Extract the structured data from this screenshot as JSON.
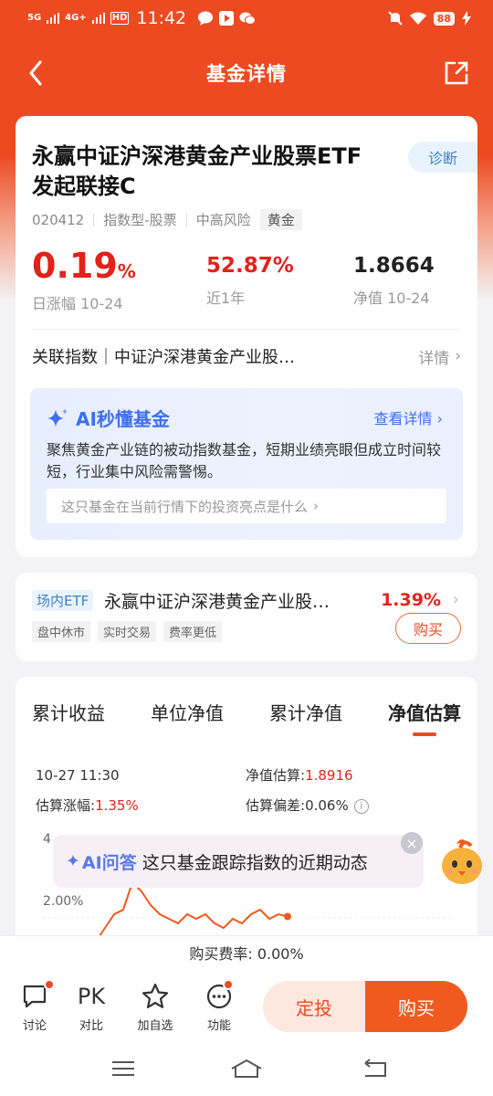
{
  "statusbar": {
    "network1": "5G",
    "network2": "4G+",
    "hd": "HD",
    "time": "11:42",
    "battery": "88"
  },
  "nav": {
    "title": "基金详情"
  },
  "fund": {
    "diag_label": "诊断",
    "name": "永赢中证沪深港黄金产业股票ETF发起联接C",
    "code": "020412",
    "type": "指数型-股票",
    "risk": "中高风险",
    "tag": "黄金",
    "daily_change": "0.19",
    "daily_change_unit": "%",
    "daily_change_label": "日涨幅 10-24",
    "year_return": "52.87%",
    "year_return_label": "近1年",
    "nav": "1.8664",
    "nav_label": "净值 10-24"
  },
  "related_index": {
    "label": "关联指数｜中证沪深港黄金产业股…",
    "detail": "详情"
  },
  "ai_summary": {
    "title": "AI秒懂基金",
    "more": "查看详情",
    "desc": "聚焦黄金产业链的被动指数基金，短期业绩亮眼但成立时间较短，行业集中风险需警惕。",
    "question": "这只基金在当前行情下的投资亮点是什么"
  },
  "etf": {
    "tag": "场内ETF",
    "name": "永赢中证沪深港黄金产业股…",
    "change": "1.39%",
    "tags": [
      "盘中休市",
      "实时交易",
      "费率更低"
    ],
    "buy": "购买"
  },
  "chart_tabs": [
    "累计收益",
    "单位净值",
    "累计净值",
    "净值估算"
  ],
  "estimate": {
    "time": "10-27 11:30",
    "nav_est_label": "净值估算:",
    "nav_est": "1.8916",
    "change_label": "估算涨幅:",
    "change": "1.35%",
    "deviation_label": "估算偏差:",
    "deviation": "0.06%"
  },
  "chart_data": {
    "type": "line",
    "ytick_labels": [
      "4",
      "2.00%"
    ],
    "color": "#ee5a1e",
    "values": [
      0.8,
      1.1,
      1.4,
      1.5,
      2.1,
      1.9,
      1.6,
      1.4,
      1.3,
      1.2,
      1.4,
      1.3,
      1.4,
      1.2,
      1.1,
      1.3,
      1.2,
      1.4,
      1.5,
      1.3,
      1.4,
      1.35
    ]
  },
  "ai_float": {
    "tag": "AI问答",
    "text": "这只基金跟踪指数的近期动态"
  },
  "fee": "购买费率: 0.00%",
  "bottombar": {
    "items": [
      {
        "icon": "",
        "label": "讨论"
      },
      {
        "icon": "PK",
        "label": "对比"
      },
      {
        "icon": "",
        "label": "加自选"
      },
      {
        "icon": "",
        "label": "功能"
      }
    ],
    "dingtou": "定投",
    "buy": "购买"
  }
}
